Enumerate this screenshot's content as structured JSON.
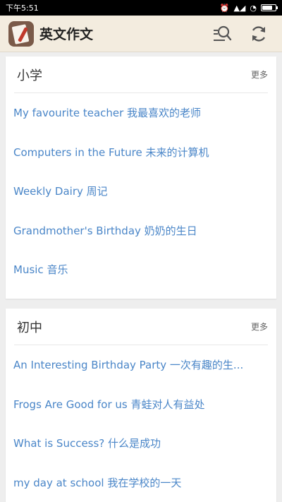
{
  "status_bar": {
    "time": "下午5:51",
    "alarm_glyph": "⏰",
    "signal_glyph": "▲◢",
    "wifi_glyph": "◔",
    "battery_level": 0.85
  },
  "app_bar": {
    "title": "英文作文",
    "icons": [
      "app-logo",
      "search-icon",
      "refresh-icon"
    ]
  },
  "sections": [
    {
      "title": "小学",
      "more_label": "更多",
      "articles": [
        "My favourite teacher 我最喜欢的老师",
        "Computers in the Future 未来的计算机",
        "Weekly Dairy 周记",
        "Grandmother's Birthday 奶奶的生日",
        "Music 音乐"
      ]
    },
    {
      "title": "初中",
      "more_label": "更多",
      "articles": [
        "An Interesting Birthday Party 一次有趣的生...",
        "Frogs Are Good for us 青蛙对人有益处",
        "What is Success? 什么是成功",
        "my day at school 我在学校的一天"
      ]
    }
  ],
  "colors": {
    "app_bar_bg": "#f3ecdf",
    "link": "#4a86c8",
    "page_bg": "#eeeeee"
  }
}
